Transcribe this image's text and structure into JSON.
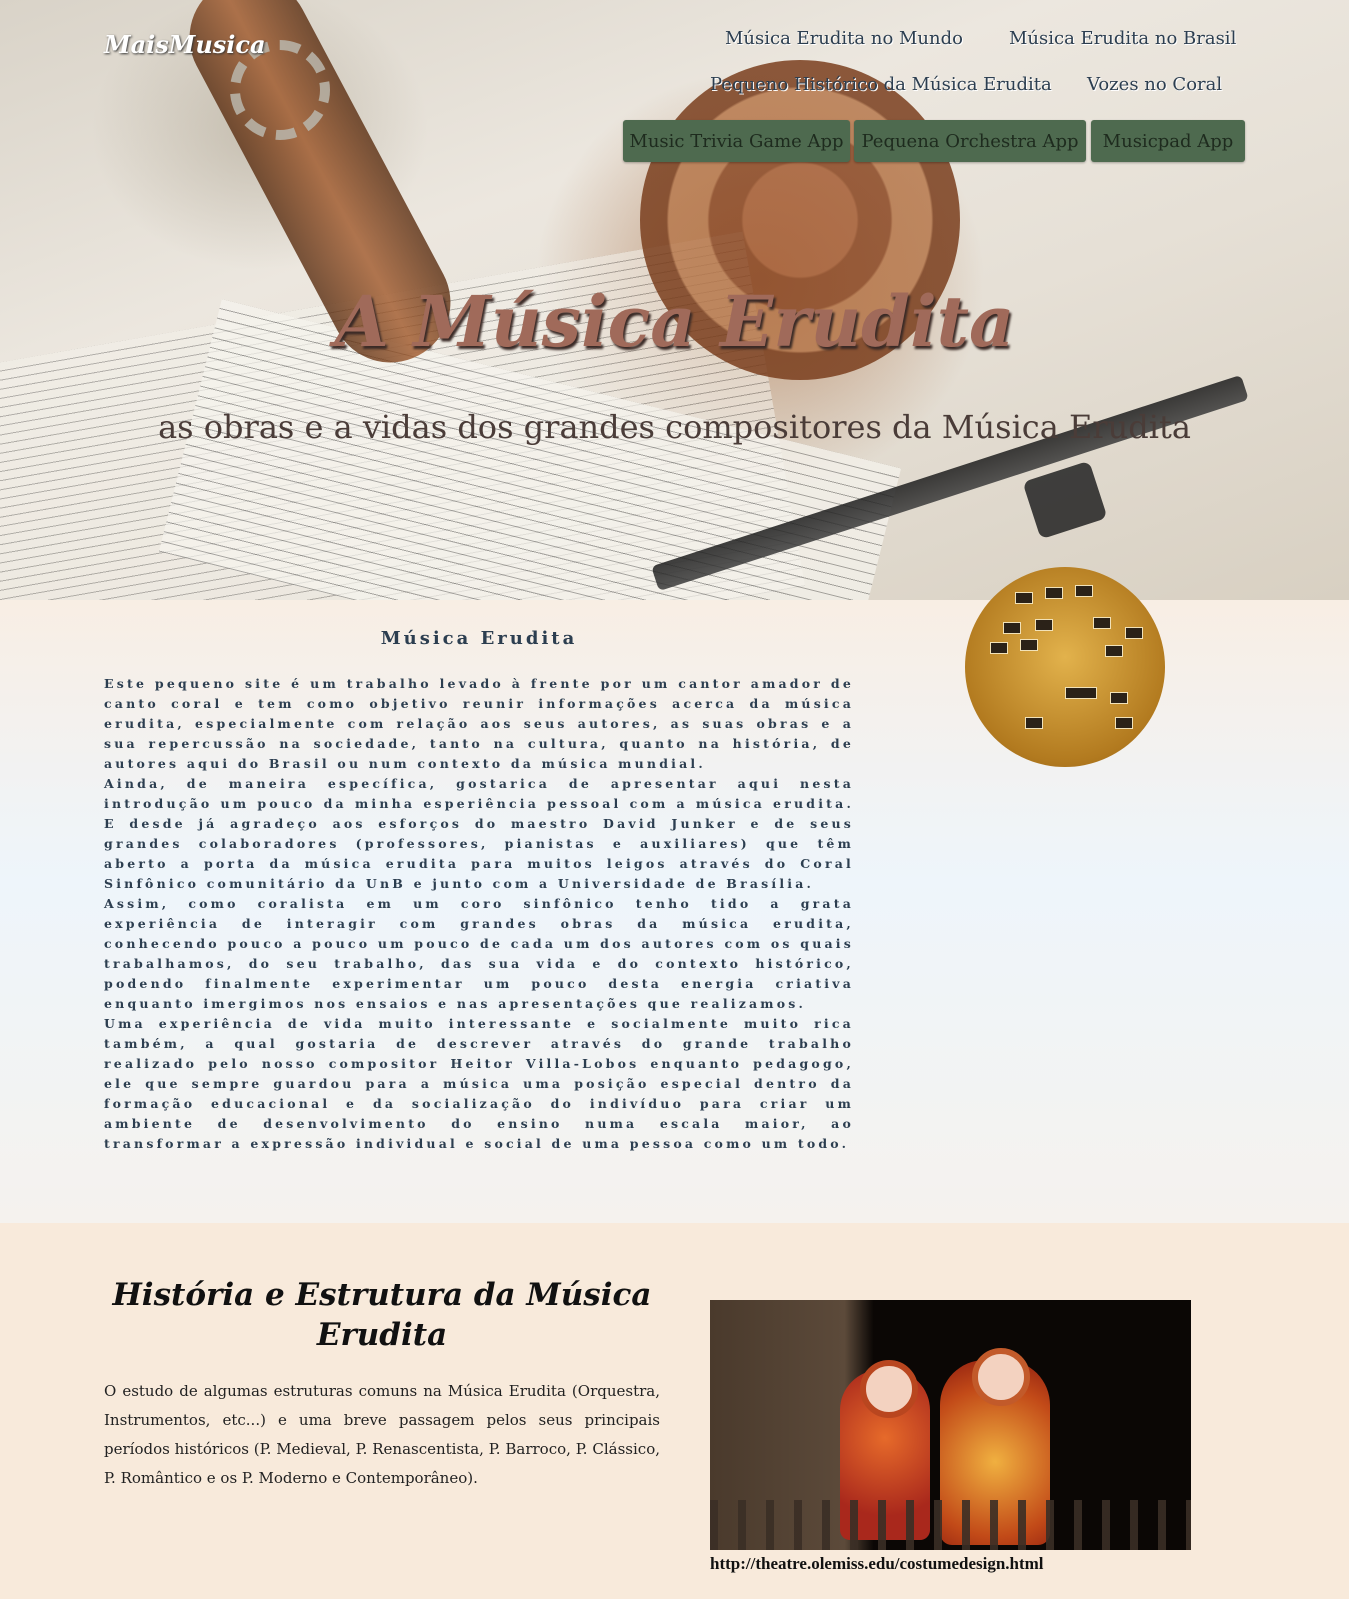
{
  "header": {
    "logo": "MaisMusica",
    "nav": [
      {
        "label": "Música Erudita no Mundo"
      },
      {
        "label": "Música Erudita no Brasil"
      },
      {
        "label": "Pequeno Histórico da Música Erudita"
      },
      {
        "label": "Vozes no Coral"
      }
    ],
    "apps": [
      {
        "label": "Music Trivia Game App"
      },
      {
        "label": "Pequena Orchestra App"
      },
      {
        "label": "Musicpad App"
      }
    ],
    "button_color": "#4e6a4f"
  },
  "hero": {
    "title": "A Música Erudita",
    "subtitle": "as obras e a vidas dos grandes compositores da Música Erudita"
  },
  "intro": {
    "title": "Música Erudita",
    "paragraphs": [
      "Este pequeno site é um trabalho levado à frente por um cantor amador de canto coral e tem como objetivo reunir informações acerca da música erudita, especialmente com relação aos seus autores, as suas obras e a sua repercussão na sociedade, tanto na cultura, quanto na história, de autores aqui do Brasil ou num contexto da música mundial.",
      "Ainda, de maneira específica, gostarica de apresentar aqui nesta introdução um pouco da minha esperiência pessoal com a música erudita. E desde já agradeço aos esforços do maestro David Junker e de seus grandes colaboradores (professores, pianistas e auxiliares) que têm aberto a porta da música erudita para muitos leigos através do Coral Sinfônico comunitário da UnB e junto com a Universidade de Brasília.",
      "Assim, como coralista em um coro sinfônico tenho tido a grata experiência de interagir com grandes obras da música erudita, conhecendo pouco a pouco um pouco de cada um dos autores com os quais trabalhamos, do seu trabalho, das sua vida e do contexto histórico, podendo finalmente experimentar um pouco desta energia criativa enquanto imergimos nos ensaios e nas apresentações que realizamos.",
      "Uma experiência de vida muito interessante e socialmente muito rica também, a qual gostaria de descrever através do grande trabalho realizado pelo nosso compositor Heitor Villa-Lobos enquanto pedagogo, ele que sempre guardou para a música uma posição especial dentro da formação educacional e da socialização do indivíduo para criar um ambiente de desenvolvimento do ensino numa escala maior, ao transformar a expressão individual e social de uma pessoa como um todo."
    ]
  },
  "history": {
    "title": "História e Estrutura da Música Erudita",
    "body": "O estudo de algumas estruturas comuns na Música Erudita (Orquestra, Instrumentos, etc...) e uma breve passagem pelos seus principais períodos históricos (P. Medieval, P. Renascentista, P. Barroco, P. Clássico, P. Romântico e os P. Moderno e Contemporâneo).",
    "image_caption": "http://theatre.olemiss.edu/costumedesign.html"
  }
}
